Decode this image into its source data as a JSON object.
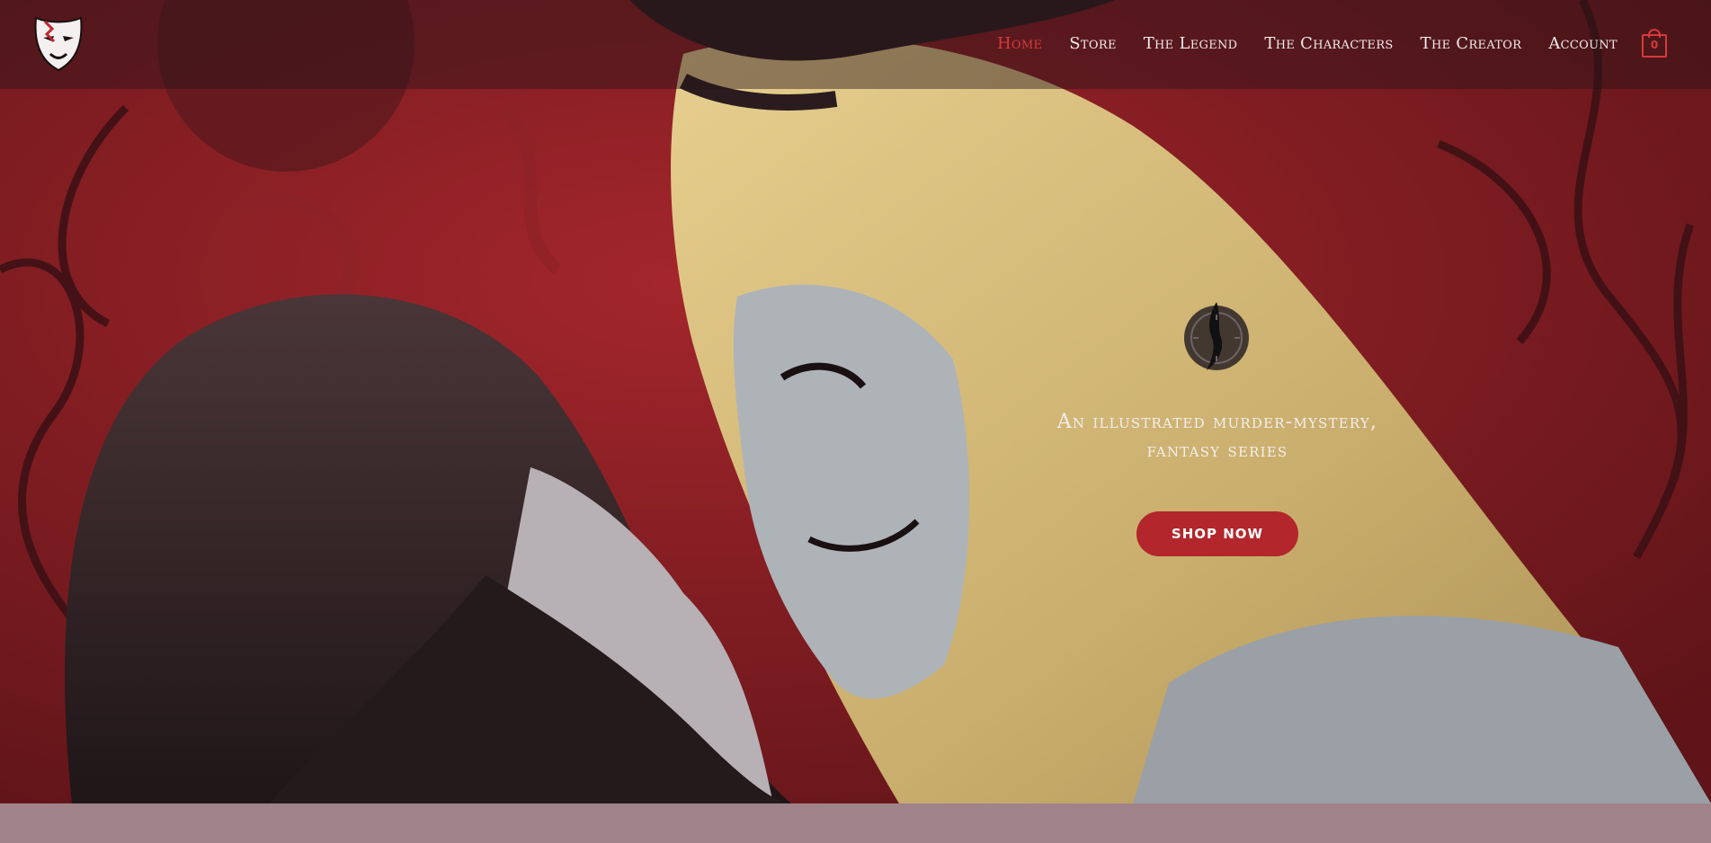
{
  "colors": {
    "brand_red": "#b3262b",
    "nav_active": "#d83a3a",
    "hero_bg": "#7e1d22",
    "band_bg": "#a0838a"
  },
  "header": {
    "logo_icon": "theater-mask-icon",
    "nav": [
      {
        "label": "Home",
        "active": true
      },
      {
        "label": "Store",
        "active": false
      },
      {
        "label": "The Legend",
        "active": false
      },
      {
        "label": "The Characters",
        "active": false
      },
      {
        "label": "The Creator",
        "active": false
      },
      {
        "label": "Account",
        "active": false
      }
    ],
    "cart": {
      "icon": "shopping-bag-icon",
      "count": "0"
    }
  },
  "hero": {
    "emblem_icon": "crest-emblem-icon",
    "tagline_line1": "An illustrated murder-mystery,",
    "tagline_line2": "fantasy series",
    "cta_label": "SHOP NOW"
  }
}
